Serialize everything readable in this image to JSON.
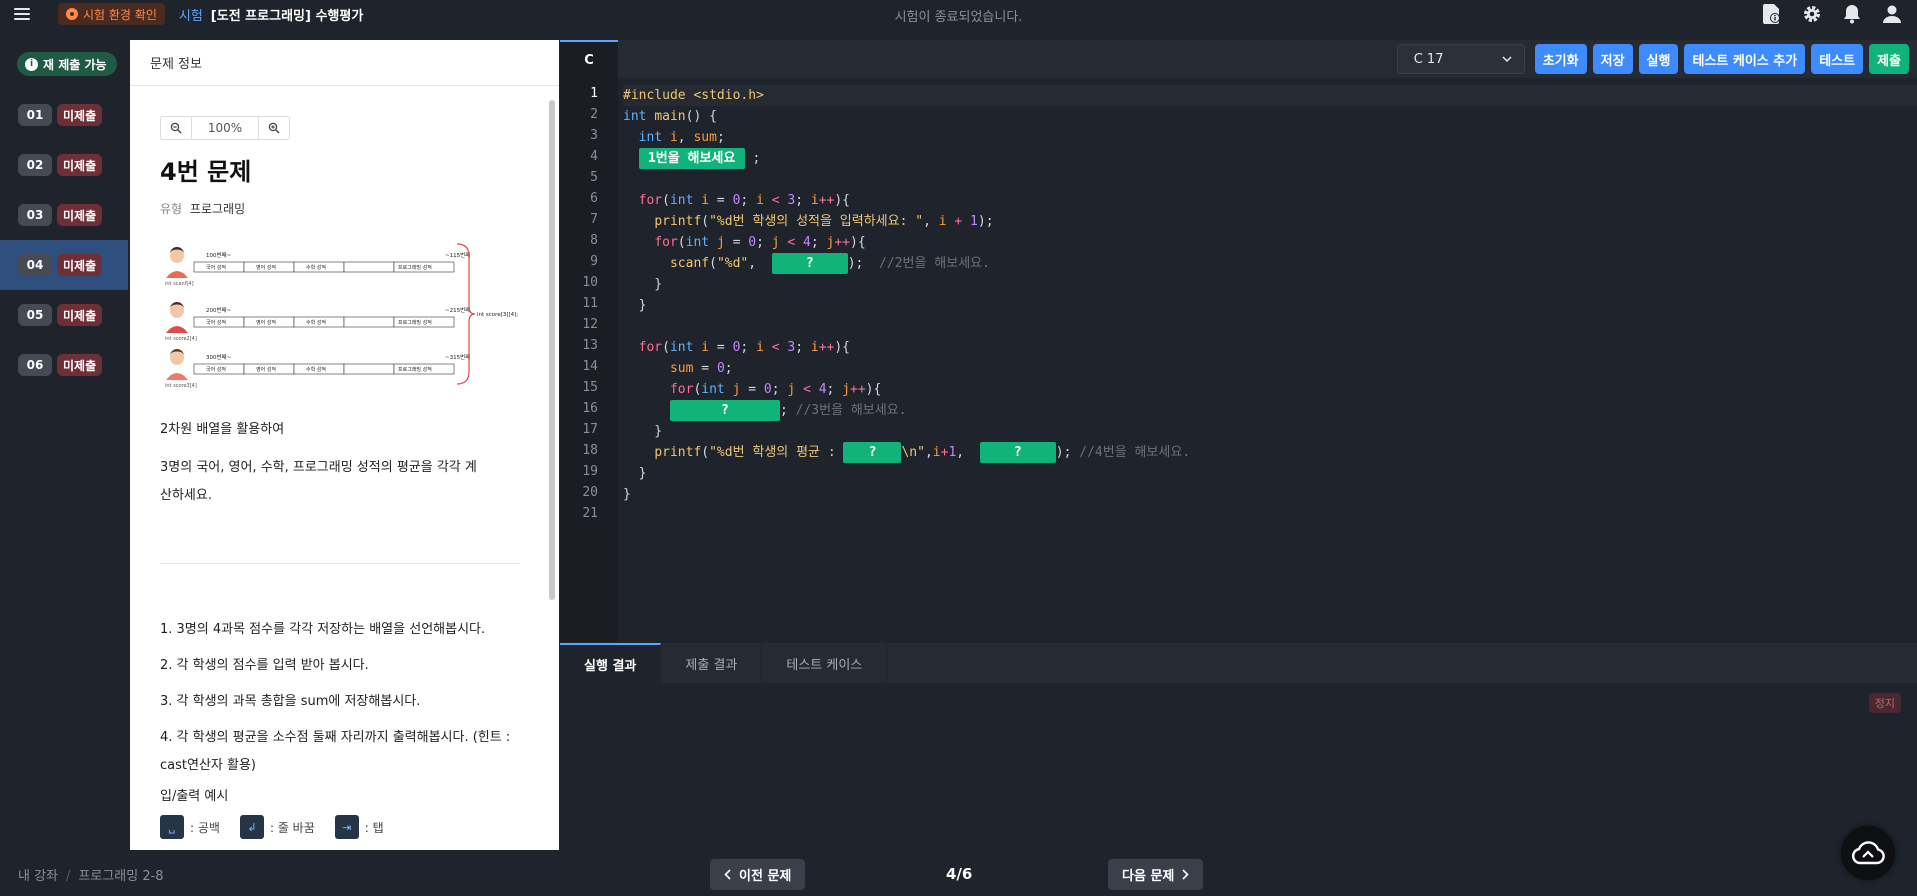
{
  "header": {
    "env_check": "시험 환경 확인",
    "exam_crumb": "시험",
    "title": "[도전 프로그래밍] 수행평가",
    "status": "시험이 종료되었습니다."
  },
  "sidebar": {
    "resubmit_label": "재 제출 가능",
    "questions": [
      {
        "num": "01",
        "state": "미제출"
      },
      {
        "num": "02",
        "state": "미제출"
      },
      {
        "num": "03",
        "state": "미제출"
      },
      {
        "num": "04",
        "state": "미제출"
      },
      {
        "num": "05",
        "state": "미제출"
      },
      {
        "num": "06",
        "state": "미제출"
      }
    ],
    "active_index": 3
  },
  "problem": {
    "header": "문제 정보",
    "zoom": "100%",
    "title": "4번 문제",
    "type_label": "유형",
    "type_value": "프로그래밍",
    "figure": {
      "rows": [
        {
          "start": "100번째~",
          "end": "~115번째",
          "var": "int scanf[4]"
        },
        {
          "start": "200번째~",
          "end": "~215번째",
          "var": "int score2[4]"
        },
        {
          "start": "300번째~",
          "end": "~315번째",
          "var": "int score3[4]"
        }
      ],
      "cells": [
        "국어 성적",
        "영어 성적",
        "수학 성적",
        "프로그래밍 성적"
      ],
      "array_label": "int score[3][4];"
    },
    "desc1": "2차원 배열을 활용하여",
    "desc2": "3명의 국어, 영어, 수학, 프로그래밍 성적의 평균을 각각 계산하세요.",
    "steps": [
      "1. 3명의 4과목 점수를 각각 저장하는 배열을 선언해봅시다.",
      "2. 각 학생의 점수를 입력 받아 봅시다.",
      "3. 각 학생의 과목 총합을 sum에 저장해봅시다.",
      "4. 각 학생의 평균을 소수점 둘째 자리까지 출력해봅시다. (힌트 : cast연산자 활용)"
    ],
    "io_label": "입/출력 예시",
    "legend": [
      {
        "key": "␣",
        "label": ": 공백"
      },
      {
        "key": "↲",
        "label": ": 줄 바꿈"
      },
      {
        "key": "⇥",
        "label": ": 탭"
      }
    ]
  },
  "editor": {
    "file_tab": "C",
    "language": "C 17",
    "buttons": {
      "reset": "초기화",
      "save": "저장",
      "run": "실행",
      "add_testcase": "테스트 케이스 추가",
      "test": "테스트",
      "submit": "제출"
    },
    "line_numbers": [
      "1",
      "2",
      "3",
      "4",
      "5",
      "6",
      "7",
      "8",
      "9",
      "10",
      "11",
      "12",
      "13",
      "14",
      "15",
      "16",
      "17",
      "18",
      "19",
      "20",
      "21"
    ],
    "code": {
      "l1": "#include <stdio.h>",
      "blank1": "1번을 해보세요",
      "blank2": "?",
      "blank3": "?",
      "blank4a": "?",
      "blank4b": "?",
      "c9": "//2번을 해보세요.",
      "c16": "//3번을 해보세요.",
      "c18": "//4번을 해보세요.",
      "s7": "\"%d번 학생의 성적을 입력하세요: \"",
      "s9": "\"%d\"",
      "s18a": "\"%d번 학생의 평균 : ",
      "s18b": "\\n\""
    }
  },
  "output": {
    "tabs": [
      "실행 결과",
      "제출 결과",
      "테스트 케이스"
    ],
    "stop": "정지"
  },
  "footer": {
    "crumb1": "내 강좌",
    "crumb2": "프로그래밍 2-8",
    "prev": "이전 문제",
    "next": "다음 문제",
    "pager": "4/6"
  }
}
